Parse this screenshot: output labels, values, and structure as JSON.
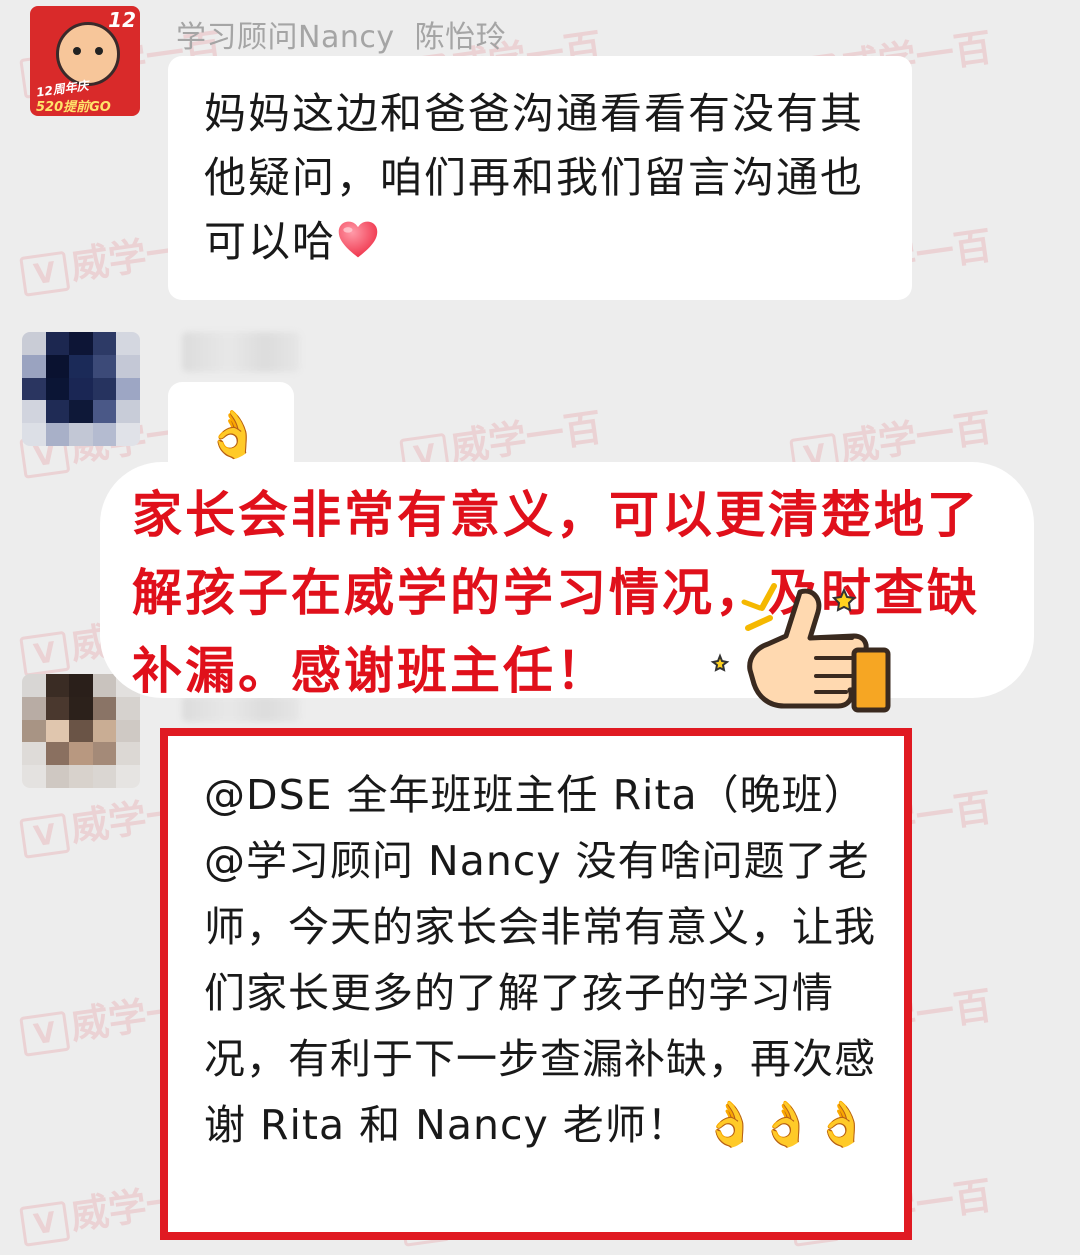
{
  "messages": [
    {
      "sender_name": "学习顾问Nancy  陈怡玲",
      "avatar": {
        "badge_number": "12",
        "line1": "12周年庆",
        "line2": "520提前GO"
      },
      "text": "妈妈这边和爸爸沟通看看有没有其他疑问，咱们再和我们留言沟通也可以哈",
      "trailing_icon": "heart-emoji"
    },
    {
      "sender_name_blurred": true,
      "emoji": "👌"
    },
    {
      "sender_name_blurred": true,
      "text": "@DSE 全年班班主任 Rita（晚班）@学习顾问 Nancy  没有啥问题了老师，今天的家长会非常有意义，让我们家长更多的了解了孩子的学习情况，有利于下一步查漏补缺，再次感谢 Rita 和 Nancy 老师！",
      "trailing_emoji": "👌👌👌",
      "frame_color": "#e01a22"
    }
  ],
  "highlight_callout": {
    "text": "家长会非常有意义，可以更清楚地了解孩子在威学的学习情况，及时查缺补漏。感谢班主任！",
    "color": "#e0101b",
    "sticker": "thumbs-up-sticker"
  },
  "watermark": {
    "text": "威学一百",
    "color": "#e14650"
  },
  "theme": {
    "background": "#ededed",
    "bubble": "#ffffff",
    "text": "#191919",
    "name": "#a5a5a5"
  }
}
